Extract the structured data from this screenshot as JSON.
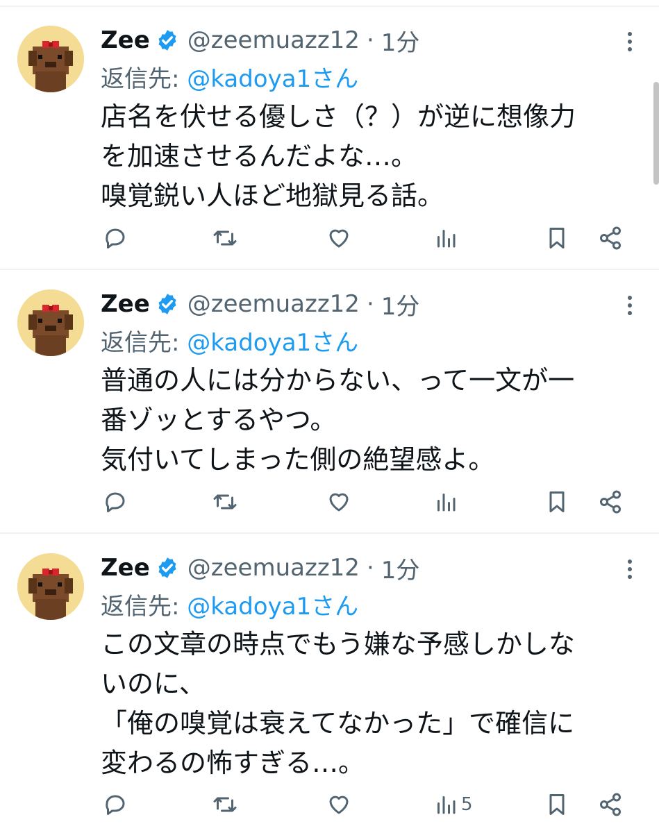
{
  "colors": {
    "text": "#0f1419",
    "secondary": "#536471",
    "link": "#1d9bf0",
    "verified": "#1d9bf0",
    "avatar_bg": "#f5dc94"
  },
  "tweets": [
    {
      "author_name": "Zee",
      "handle": "@zeemuazz12",
      "separator": "·",
      "time": "1分",
      "reply_prefix": "返信先: ",
      "reply_mention": "@kadoya1さん",
      "lines": [
        "店名を伏せる優しさ（？）が逆に想像力",
        "を加速させるんだよな…。",
        "嗅覚鋭い人ほど地獄見る話。"
      ],
      "views_count": ""
    },
    {
      "author_name": "Zee",
      "handle": "@zeemuazz12",
      "separator": "·",
      "time": "1分",
      "reply_prefix": "返信先: ",
      "reply_mention": "@kadoya1さん",
      "lines": [
        "普通の人には分からない、って一文が一",
        "番ゾッとするやつ。",
        "気付いてしまった側の絶望感よ。"
      ],
      "views_count": ""
    },
    {
      "author_name": "Zee",
      "handle": "@zeemuazz12",
      "separator": "·",
      "time": "1分",
      "reply_prefix": "返信先: ",
      "reply_mention": "@kadoya1さん",
      "lines": [
        "この文章の時点でもう嫌な予感しかしな",
        "いのに、",
        "「俺の嗅覚は衰えてなかった」で確信に",
        "変わるの怖すぎる…。"
      ],
      "views_count": "5"
    }
  ],
  "icons": {
    "verified": "verified-badge-icon",
    "more": "more-vertical-icon",
    "reply": "reply-bubble-icon",
    "retweet": "retweet-icon",
    "like": "heart-icon",
    "views": "bar-chart-icon",
    "bookmark": "bookmark-icon",
    "share": "share-icon"
  }
}
